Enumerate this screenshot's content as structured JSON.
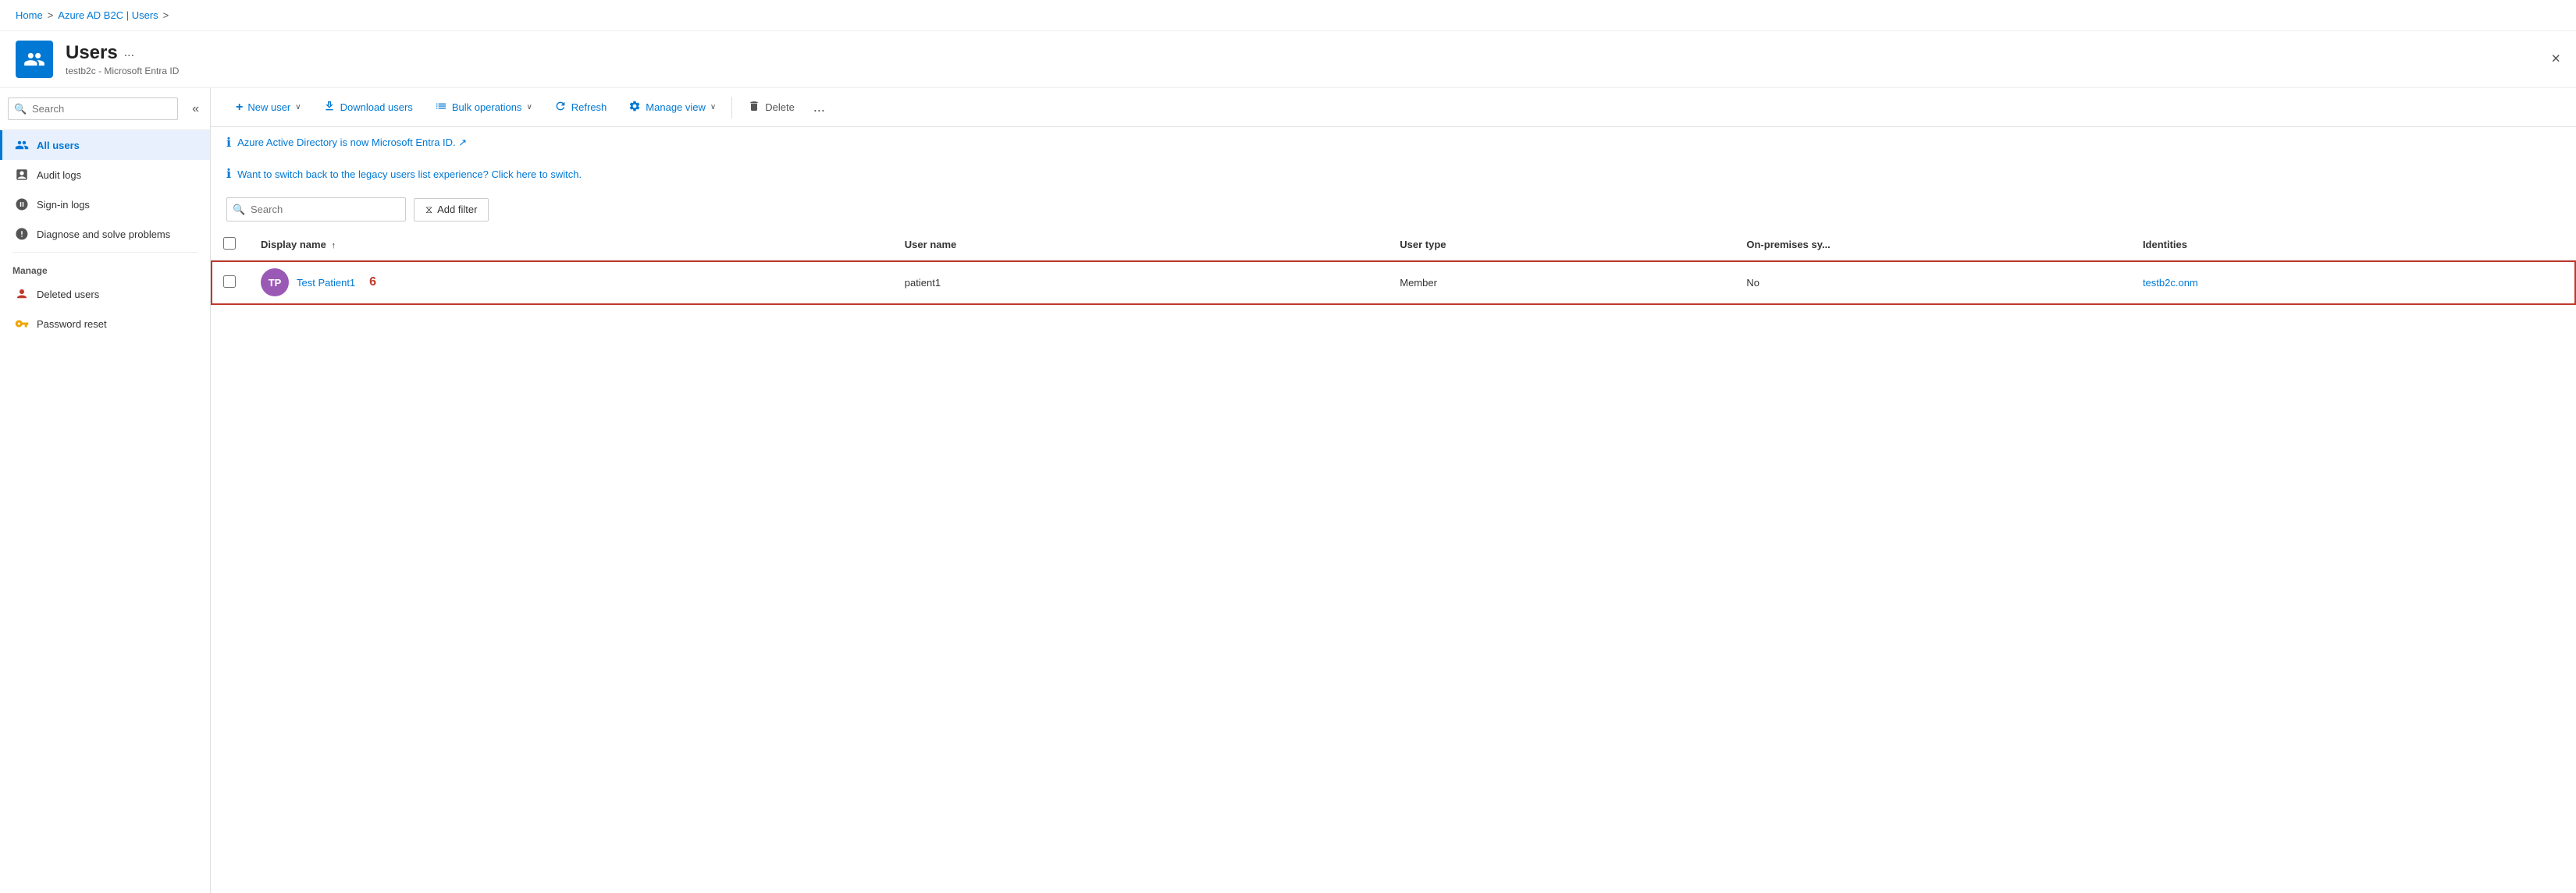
{
  "breadcrumb": {
    "home": "Home",
    "separator1": ">",
    "parent": "Azure AD B2C | Users",
    "separator2": ">"
  },
  "header": {
    "title": "Users",
    "ellipsis": "...",
    "subtitle": "testb2c - Microsoft Entra ID",
    "close_label": "×"
  },
  "sidebar": {
    "search_placeholder": "Search",
    "collapse_label": "«",
    "nav_items": [
      {
        "id": "all-users",
        "label": "All users",
        "icon": "users",
        "active": true
      },
      {
        "id": "audit-logs",
        "label": "Audit logs",
        "icon": "audit",
        "active": false
      },
      {
        "id": "sign-in-logs",
        "label": "Sign-in logs",
        "icon": "signin",
        "active": false
      },
      {
        "id": "diagnose",
        "label": "Diagnose and solve problems",
        "icon": "wrench",
        "active": false
      }
    ],
    "manage_section": "Manage",
    "manage_items": [
      {
        "id": "deleted-users",
        "label": "Deleted users",
        "icon": "deleted"
      },
      {
        "id": "password-reset",
        "label": "Password reset",
        "icon": "key"
      }
    ]
  },
  "toolbar": {
    "new_user_label": "New user",
    "new_user_chevron": "∨",
    "download_label": "Download users",
    "bulk_label": "Bulk operations",
    "bulk_chevron": "∨",
    "refresh_label": "Refresh",
    "manage_view_label": "Manage view",
    "manage_view_chevron": "∨",
    "delete_label": "Delete",
    "more_label": "..."
  },
  "banners": [
    {
      "id": "banner1",
      "text": "Azure Active Directory is now Microsoft Entra ID.",
      "link_text": "Azure Active Directory is now Microsoft Entra ID. ↗",
      "href": "#"
    },
    {
      "id": "banner2",
      "text": "Want to switch back to the legacy users list experience? Click here to switch.",
      "link_text": "Want to switch back to the legacy users list experience? Click here to switch.",
      "href": "#"
    }
  ],
  "filter_row": {
    "search_placeholder": "Search",
    "add_filter_label": "Add filter",
    "filter_icon": "⧖"
  },
  "table": {
    "columns": [
      {
        "id": "checkbox",
        "label": ""
      },
      {
        "id": "display_name",
        "label": "Display name",
        "sort": "↑"
      },
      {
        "id": "user_name",
        "label": "User name"
      },
      {
        "id": "user_type",
        "label": "User type"
      },
      {
        "id": "on_premises",
        "label": "On-premises sy..."
      },
      {
        "id": "identities",
        "label": "Identities"
      }
    ],
    "rows": [
      {
        "id": "row1",
        "checkbox": false,
        "avatar_initials": "TP",
        "avatar_color": "#9b59b6",
        "display_name": "Test Patient1",
        "row_number": "6",
        "user_name": "patient1",
        "user_type": "Member",
        "on_premises": "No",
        "identities": "testb2c.onm",
        "highlighted": true
      }
    ]
  }
}
